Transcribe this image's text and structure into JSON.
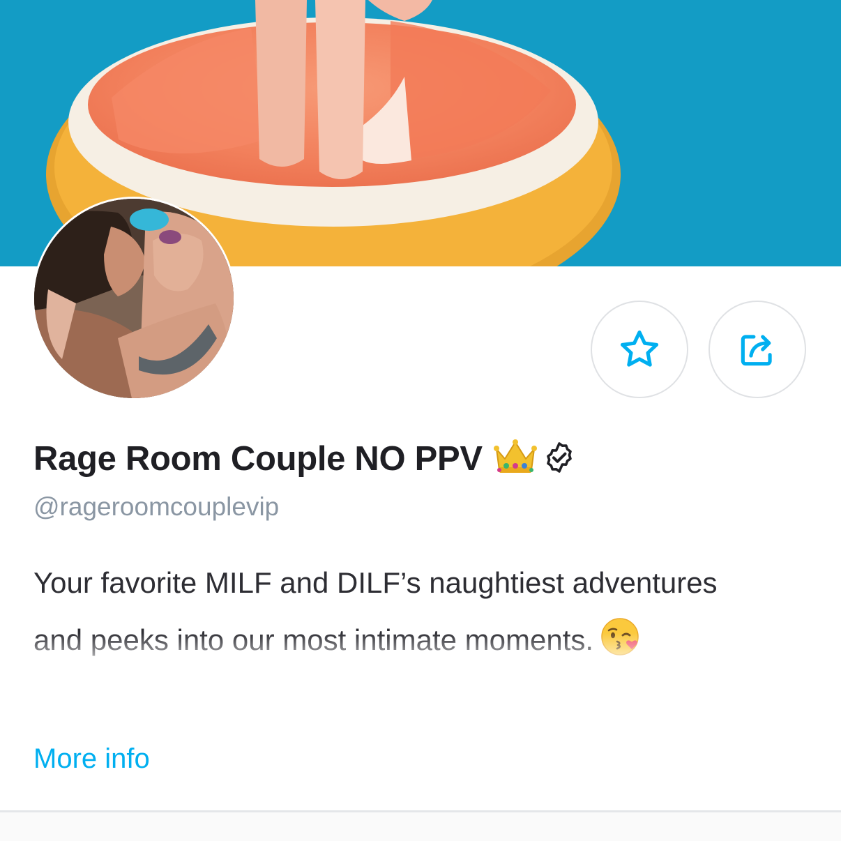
{
  "profile": {
    "display_name": "Rage Room Couple NO PPV",
    "username": "@rageroomcouplevip",
    "bio_line_1": "Your favorite MILF and DILF’s naughtiest adventures",
    "bio_line_2": "and peeks into our most intimate moments.",
    "more_info_label": "More info",
    "verified": true
  },
  "icons": {
    "name_badge": "crown-icon",
    "verified_badge": "verified-icon",
    "favorite_button": "star-icon",
    "share_button": "share-icon",
    "bio_emoji": "kissing-face-icon"
  },
  "colors": {
    "accent": "#00aff0",
    "name_text": "#1f1f24",
    "username_text": "#8a96a3",
    "cover_background": "#149ec6",
    "button_border": "#dfe1e4"
  }
}
